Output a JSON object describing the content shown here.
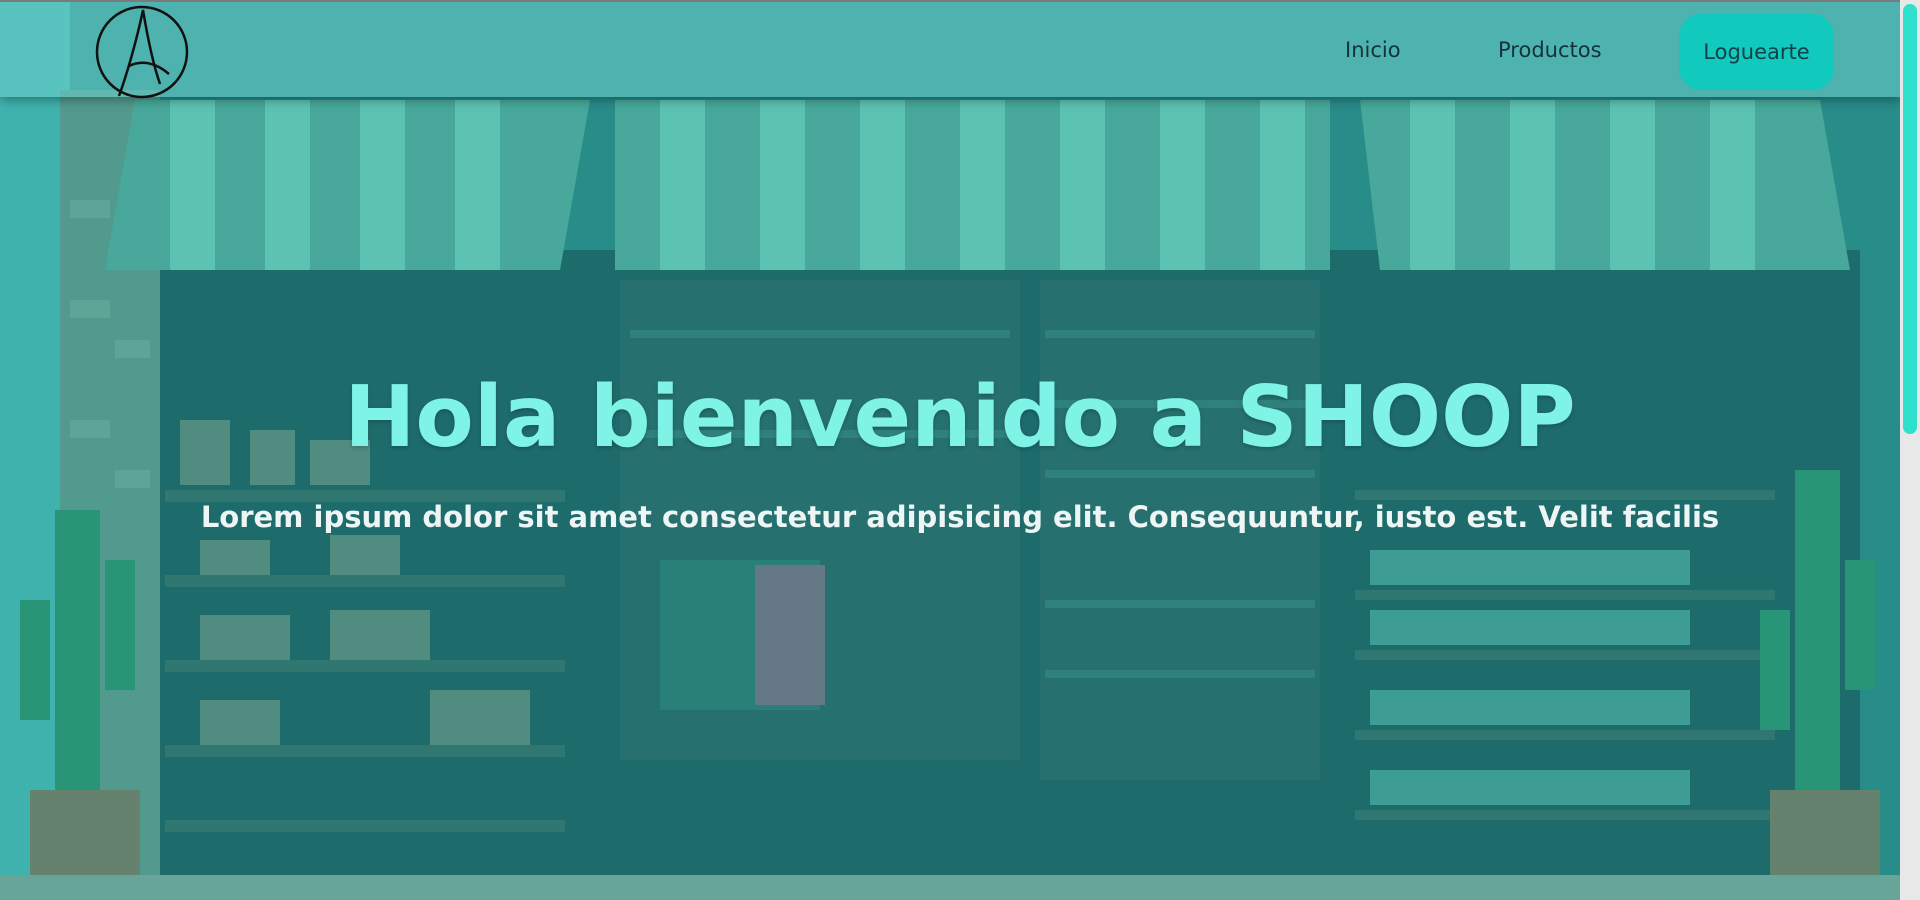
{
  "nav": {
    "logo_icon": "anarchy-style-a-logo-icon",
    "links": [
      "Inicio",
      "Productos"
    ],
    "login_label": "Loguearte"
  },
  "hero": {
    "title": "Hola bienvenido a SHOOP",
    "subtitle": "Lorem ipsum dolor sit amet consectetur adipisicing elit. Consequuntur, iusto est. Velit facilis",
    "background": "illustrated-storefront-image"
  },
  "colors": {
    "navbar": "#6ed2cd",
    "login_button": "#12c9bd",
    "title": "#7ff4e6",
    "subtitle": "#eef6f5",
    "scroll_thumb": "#2fe0cc"
  }
}
